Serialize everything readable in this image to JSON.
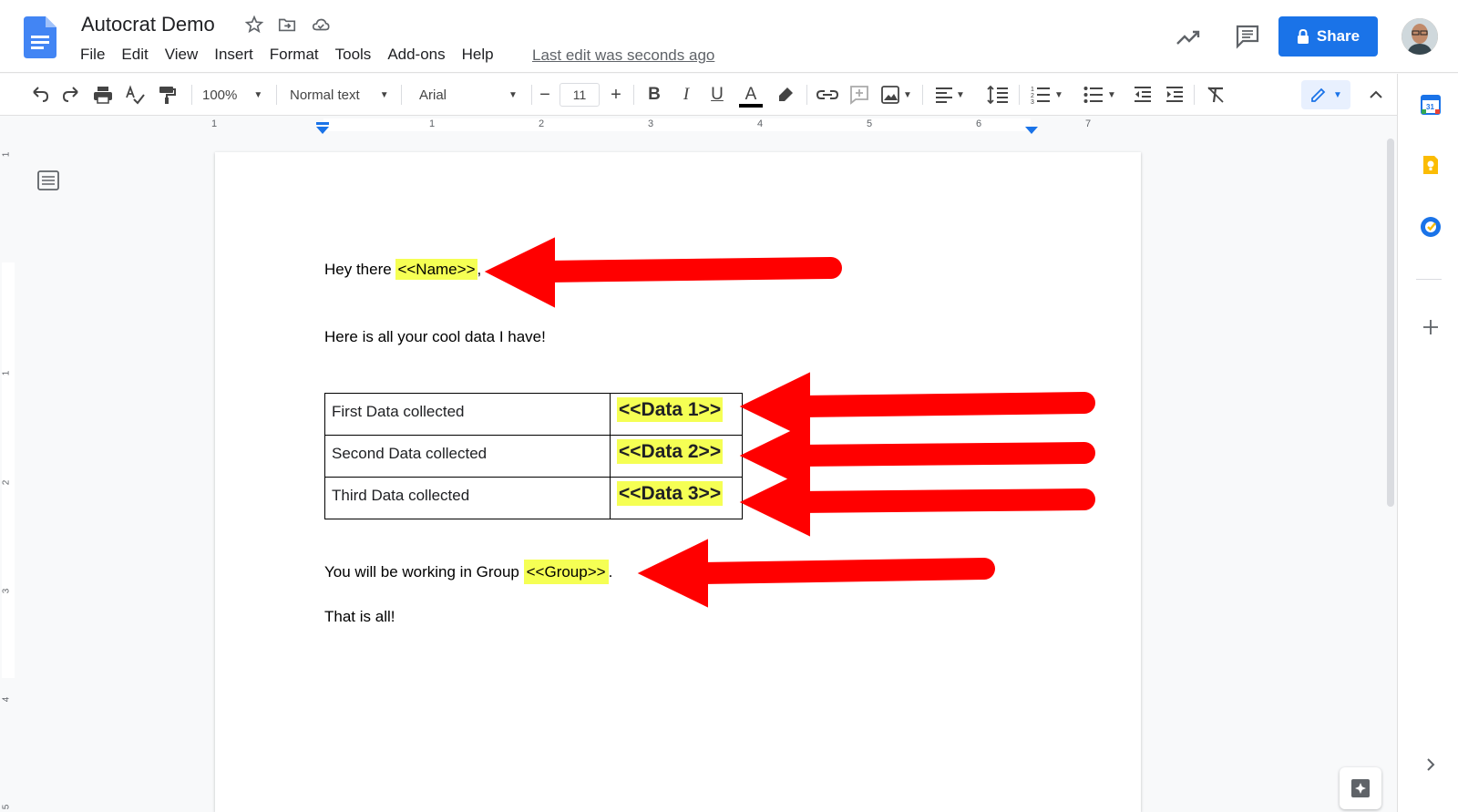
{
  "header": {
    "title": "Autocrat Demo",
    "menu": [
      "File",
      "Edit",
      "View",
      "Insert",
      "Format",
      "Tools",
      "Add-ons",
      "Help"
    ],
    "last_edit": "Last edit was seconds ago",
    "share_label": "Share"
  },
  "toolbar": {
    "zoom": "100%",
    "style": "Normal text",
    "font": "Arial",
    "font_size": "11"
  },
  "ruler": {
    "numbers": [
      "1",
      "1",
      "2",
      "3",
      "4",
      "5",
      "6",
      "7"
    ],
    "vertical_numbers": [
      "1",
      "1",
      "2",
      "3",
      "4",
      "5"
    ]
  },
  "document": {
    "greeting_prefix": "Hey there ",
    "name_tag": "<<Name>>",
    "greeting_suffix": ",",
    "intro": "Here is all your cool data I have!",
    "table": [
      {
        "label": "First Data collected",
        "tag": "<<Data 1>>"
      },
      {
        "label": "Second Data collected",
        "tag": "<<Data 2>>"
      },
      {
        "label": "Third Data collected",
        "tag": "<<Data 3>>"
      }
    ],
    "group_prefix": "You will be working in Group ",
    "group_tag": "<<Group>>",
    "group_suffix": ".",
    "closing": "That is all!"
  },
  "colors": {
    "accent": "#1a73e8",
    "highlight": "#f5ff54",
    "arrow": "#ff0000"
  }
}
